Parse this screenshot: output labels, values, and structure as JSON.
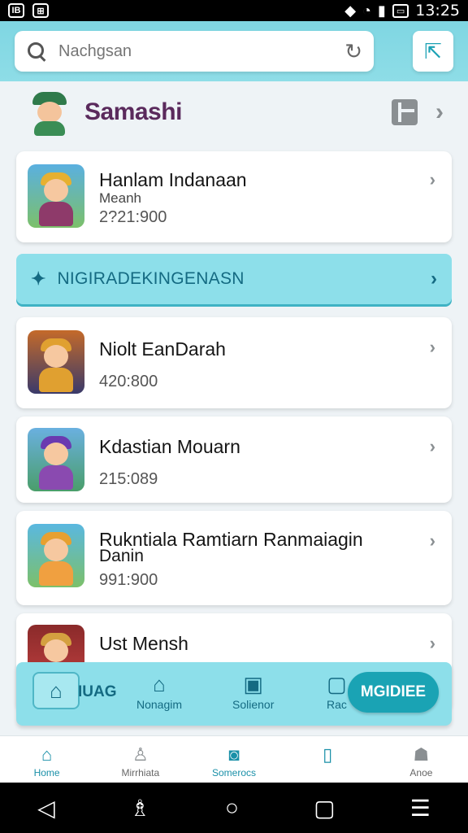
{
  "status_bar": {
    "time": "13:25",
    "left_icons": [
      "IB",
      "⊞"
    ],
    "battery": "▭"
  },
  "search": {
    "placeholder": "Nachgsan",
    "value": ""
  },
  "profile": {
    "name": "Samashi"
  },
  "cards": [
    {
      "title": "Hanlam Indanaan",
      "subtitle": "Meanh",
      "number": "2?21:900",
      "colors": [
        "#5ab0e0",
        "#e6b030",
        "#8e3a6a"
      ]
    },
    {
      "title": "Niolt EanDarah",
      "subtitle": "",
      "number": "420:800",
      "colors": [
        "#c46a2a",
        "#3a3a6a",
        "#e0a030"
      ]
    },
    {
      "title": "Kdastian Mouarn",
      "subtitle": "",
      "number": "215:089",
      "colors": [
        "#4a9e6a",
        "#6a3ab0",
        "#8a4ab0"
      ]
    },
    {
      "title": "Rukntiala Ramtiarn Ranmaiagin",
      "subtitle": "Danin",
      "number": "991:900",
      "colors": [
        "#5ab8e0",
        "#e6a030",
        "#f0a040"
      ]
    },
    {
      "title": "Ust Mensh",
      "subtitle": "",
      "number": "",
      "colors": [
        "#8a2a2a",
        "#d4a040",
        "#c04040"
      ]
    }
  ],
  "banner": {
    "text": "NIGIRADEKINGENASN",
    "icon": "diamond-icon"
  },
  "floating_bar": {
    "home_label": "IUAG",
    "items": [
      {
        "label": "Nonagim",
        "icon": "home-icon"
      },
      {
        "label": "Solienor",
        "icon": "chat-icon"
      },
      {
        "label": "Rac",
        "icon": "box-icon"
      }
    ],
    "pill_label": "MGIDIEE"
  },
  "bottom_nav": [
    {
      "label": "Home",
      "icon": "home-icon",
      "active": true
    },
    {
      "label": "Mirrhiata",
      "icon": "person-icon",
      "active": false
    },
    {
      "label": "Somerocs",
      "icon": "face-icon",
      "active": true
    },
    {
      "label": "",
      "icon": "book-icon",
      "active": true
    },
    {
      "label": "Anoe",
      "icon": "user-icon",
      "active": false
    }
  ],
  "colors": {
    "accent": "#8ddfea",
    "accent_dark": "#146a82",
    "pill": "#1aa3b4",
    "profile_name": "#5a2a5c"
  }
}
